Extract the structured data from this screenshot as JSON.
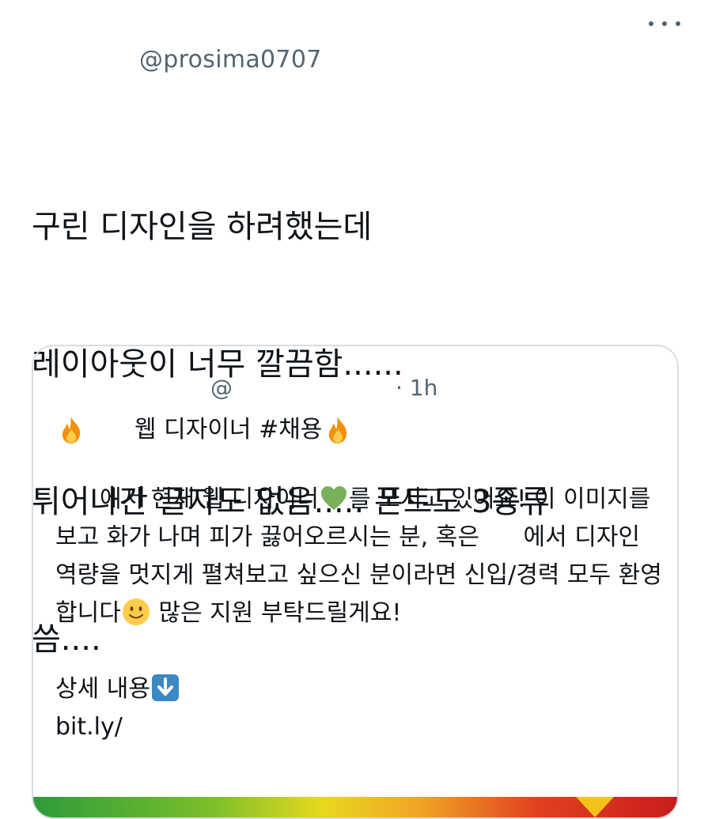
{
  "tweet": {
    "handle": "@prosima0707",
    "text_lines": [
      "구린 디자인을 하려했는데",
      "레이아웃이 너무 깔끔함......",
      "튀어나간 글자도 없음..... 폰트도 3종류",
      "씀...."
    ]
  },
  "quote": {
    "handle": "@",
    "time": "· 1h",
    "title": "웹 디자이너 #채용",
    "body": {
      "part1": "에서 현재 웹 디자이너",
      "part2": "를 모시고 있어요! 이 이미지를 보고 화가 나며 피가 끓어오르시는 분, 혹은 ",
      "part3": "에서 디자인 역량을 멋지게 펼쳐보고 싶으신 분이라면 신입/경력 모두 환영합니다",
      "part4": " 많은 지원 부탁드릴게요!",
      "detail_label": "상세 내용",
      "link": "bit.ly/"
    },
    "icons": [
      "fire-emoji",
      "green-heart-emoji",
      "smiling-face-emoji",
      "down-arrow-emoji"
    ]
  },
  "colors": {
    "text": "#0f1419",
    "secondary": "#536471",
    "border": "#d7dde2",
    "green_heart": "#78b159"
  }
}
